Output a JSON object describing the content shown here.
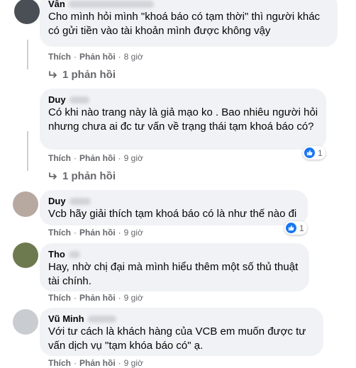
{
  "comments": [
    {
      "author": "Vân",
      "text": "Cho mình hỏi mình \"khoá báo có tạm thời\" thì người khác có gửi tiền vào tài khoản mình được không vậy",
      "like_label": "Thích",
      "reply_label": "Phản hồi",
      "time": "8 giờ",
      "replies_label": "1 phản hồi",
      "avatar_color": "#4a4e55"
    },
    {
      "author": "Duy",
      "text": "Có khi nào trang này là giả mạo ko . Bao nhiêu người hỏi nhưng chưa ai đc tư vấn về trạng thái tạm khoá báo có?",
      "like_label": "Thích",
      "reply_label": "Phản hồi",
      "time": "9 giờ",
      "reaction_count": "1",
      "replies_label": "1 phản hồi"
    },
    {
      "author": "Duy",
      "text": "Vcb hãy giải thích tạm khoá báo có là như thế nào đi",
      "like_label": "Thích",
      "reply_label": "Phản hồi",
      "time": "9 giờ",
      "reaction_count": "1",
      "avatar_color": "#b8a9a0"
    },
    {
      "author": "Tho",
      "text": "Hay, nhờ chị đại mà mình hiểu thêm một số thủ thuật tài chính.",
      "like_label": "Thích",
      "reply_label": "Phản hồi",
      "time": "9 giờ",
      "avatar_color": "#6d7a4f"
    },
    {
      "author": "Vũ Minh",
      "text": "Với tư cách là khách hàng của VCB em muốn được tư vấn dịch vụ \"tạm khóa báo có\" ạ.",
      "like_label": "Thích",
      "reply_label": "Phản hồi",
      "time": "9 giờ",
      "avatar_color": "#c9ccd1"
    }
  ],
  "colors": {
    "bubble": "#f0f2f5",
    "meta": "#65676b",
    "like_blue": "#1877f2"
  }
}
